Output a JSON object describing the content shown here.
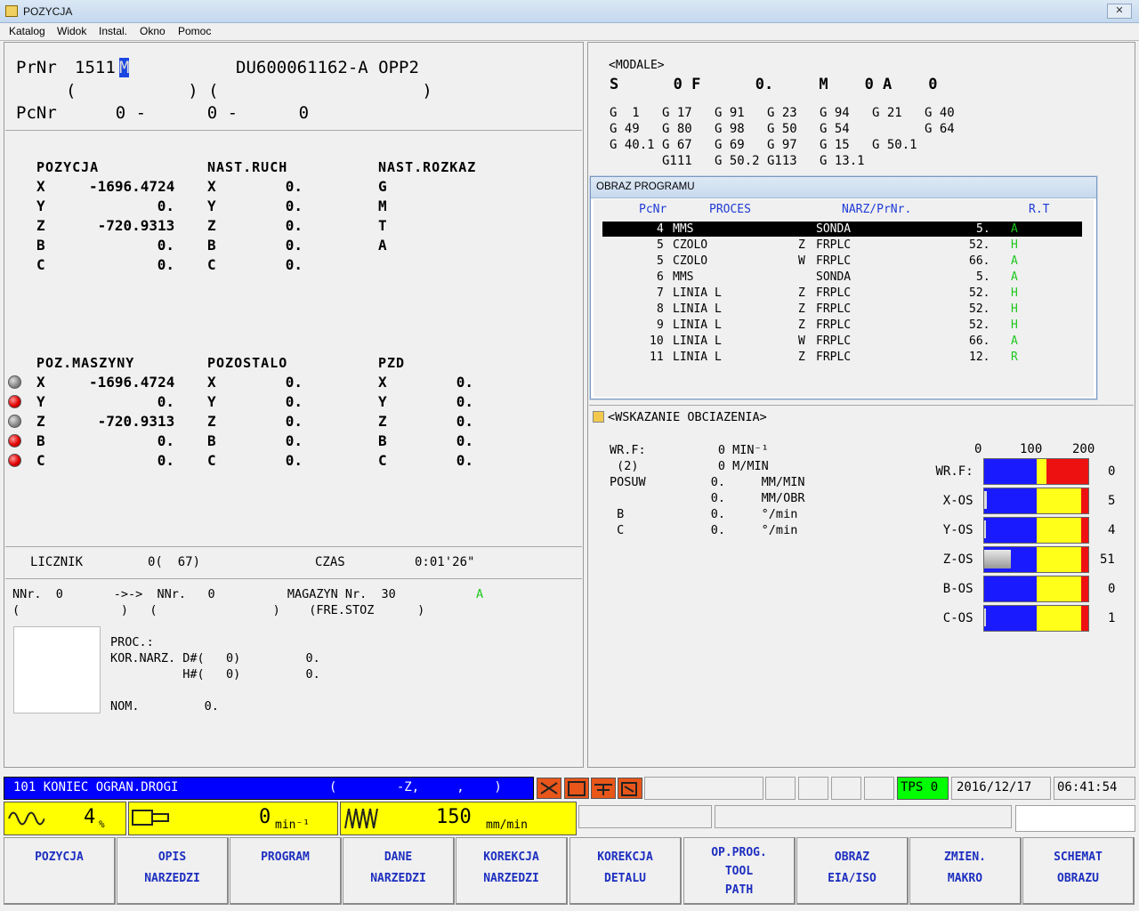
{
  "window": {
    "title": "POZYCJA",
    "close": "✕"
  },
  "menu": [
    "Katalog",
    "Widok",
    "Instal.",
    "Okno",
    "Pomoc"
  ],
  "program": {
    "prnr_label": "PrNr",
    "prnr": "1511",
    "prnr_suffix": "M",
    "name": "DU600061162-A OPP2",
    "paren_line": "(           ) (                    )",
    "pcnr_label": "PcNr",
    "pcnr_vals": "    0 -      0 -      0"
  },
  "position": {
    "headers": [
      "POZYCJA",
      "NAST.RUCH",
      "NAST.ROZKAZ"
    ],
    "axes": [
      "X",
      "Y",
      "Z",
      "B",
      "C"
    ],
    "pos": [
      "-1696.4724",
      "0.",
      "-720.9313",
      "0.",
      "0."
    ],
    "next_move": [
      "0.",
      "0.",
      "0.",
      "0.",
      "0."
    ],
    "next_cmd": [
      "G",
      "M",
      "T",
      "A"
    ]
  },
  "machine": {
    "headers": [
      "POZ.MASZYNY",
      "POZOSTALO",
      "PZD"
    ],
    "axes": [
      "X",
      "Y",
      "Z",
      "B",
      "C"
    ],
    "pos": [
      "-1696.4724",
      "0.",
      "-720.9313",
      "0.",
      "0."
    ],
    "remain": [
      "0.",
      "0.",
      "0.",
      "0.",
      "0."
    ],
    "pzd": [
      "0.",
      "0.",
      "0.",
      "0.",
      "0."
    ],
    "leds": [
      "gray",
      "red",
      "gray",
      "red",
      "red"
    ]
  },
  "counter": {
    "label": "LICZNIK",
    "value": "0(  67)",
    "time_label": "CZAS",
    "time": "0:01'26\""
  },
  "tools": {
    "line1": "NNr.  0       ->->  NNr.   0          MAGAZYN Nr.  30",
    "mag_flag": "A",
    "line2": "(              )   (                )    (FRE.STOZ      )",
    "proc": "PROC.:",
    "kor": "KOR.NARZ. D#(   0)         0.",
    "kor2": "          H#(   0)         0.",
    "nom": "NOM.         0."
  },
  "modal": {
    "title": "<MODALE>",
    "line_s": "S      0 F      0.     M    0 A    0",
    "g_rows": [
      "G  1   G 17   G 91   G 23   G 94   G 21   G 40",
      "G 49   G 80   G 98   G 50   G 54          G 64",
      "G 40.1 G 67   G 69   G 97   G 15   G 50.1",
      "       G111   G 50.2 G113   G 13.1"
    ]
  },
  "program_view": {
    "title": "OBRAZ PROGRAMU",
    "headers": [
      "PcNr",
      "PROCES",
      "NARZ/PrNr.",
      "R.T"
    ],
    "rows": [
      {
        "pc": "4",
        "proc": "MMS",
        "flag": "",
        "tool": "SONDA",
        "rt": "5.",
        "code": "A"
      },
      {
        "pc": "5",
        "proc": "CZOLO",
        "flag": "Z",
        "tool": "FRPLC",
        "rt": "52.",
        "code": "H"
      },
      {
        "pc": "5",
        "proc": "CZOLO",
        "flag": "W",
        "tool": "FRPLC",
        "rt": "66.",
        "code": "A"
      },
      {
        "pc": "6",
        "proc": "MMS",
        "flag": "",
        "tool": "SONDA",
        "rt": "5.",
        "code": "A"
      },
      {
        "pc": "7",
        "proc": "LINIA L",
        "flag": "Z",
        "tool": "FRPLC",
        "rt": "52.",
        "code": "H"
      },
      {
        "pc": "8",
        "proc": "LINIA L",
        "flag": "Z",
        "tool": "FRPLC",
        "rt": "52.",
        "code": "H"
      },
      {
        "pc": "9",
        "proc": "LINIA L",
        "flag": "Z",
        "tool": "FRPLC",
        "rt": "52.",
        "code": "H"
      },
      {
        "pc": "10",
        "proc": "LINIA L",
        "flag": "W",
        "tool": "FRPLC",
        "rt": "66.",
        "code": "A"
      },
      {
        "pc": "11",
        "proc": "LINIA L",
        "flag": "Z",
        "tool": "FRPLC",
        "rt": "12.",
        "code": "R"
      }
    ]
  },
  "load": {
    "title": "<WSKAZANIE OBCIAZENIA>",
    "left": [
      "WR.F:          0 MIN⁻¹",
      " (2)           0 M/MIN",
      "POSUW         0.     MM/MIN",
      "              0.     MM/OBR",
      " B            0.     °/min",
      " C            0.     °/min"
    ],
    "scale": [
      "0",
      "100",
      "200"
    ],
    "bars": [
      {
        "label": "WR.F:",
        "value": "0",
        "load": 0
      },
      {
        "label": "X-OS",
        "value": "5",
        "load": 5
      },
      {
        "label": "Y-OS",
        "value": "4",
        "load": 4
      },
      {
        "label": "Z-OS",
        "value": "51",
        "load": 51
      },
      {
        "label": "B-OS",
        "value": "0",
        "load": 0
      },
      {
        "label": "C-OS",
        "value": "1",
        "load": 1
      }
    ]
  },
  "status": {
    "alarm": "101 KONIEC OGRAN.DROGI",
    "alarm_axis": "(        -Z,     ,    )",
    "tps": "TPS 0",
    "date": "2016/12/17",
    "time": "06:41:54",
    "override": "4",
    "override_unit": "%",
    "spindle": "0",
    "spindle_unit": "min⁻¹",
    "feed": "150",
    "feed_unit": "mm/min"
  },
  "fkeys": [
    [
      "POZYCJA"
    ],
    [
      "OPIS",
      "NARZEDZI"
    ],
    [
      "PROGRAM"
    ],
    [
      "DANE",
      "NARZEDZI"
    ],
    [
      "KOREKCJA",
      "NARZEDZI"
    ],
    [
      "KOREKCJA",
      "DETALU"
    ],
    [
      "OP.PROG.",
      "TOOL",
      "PATH"
    ],
    [
      "OBRAZ",
      "EIA/ISO"
    ],
    [
      "ZMIEN.",
      "MAKRO"
    ],
    [
      "SCHEMAT",
      "OBRAZU"
    ]
  ],
  "colors": {
    "alarm_bg": "#0000ff",
    "status_yellow": "#ffff00",
    "tps_green": "#00ff00",
    "fkey_text": "#1d2fbf"
  }
}
